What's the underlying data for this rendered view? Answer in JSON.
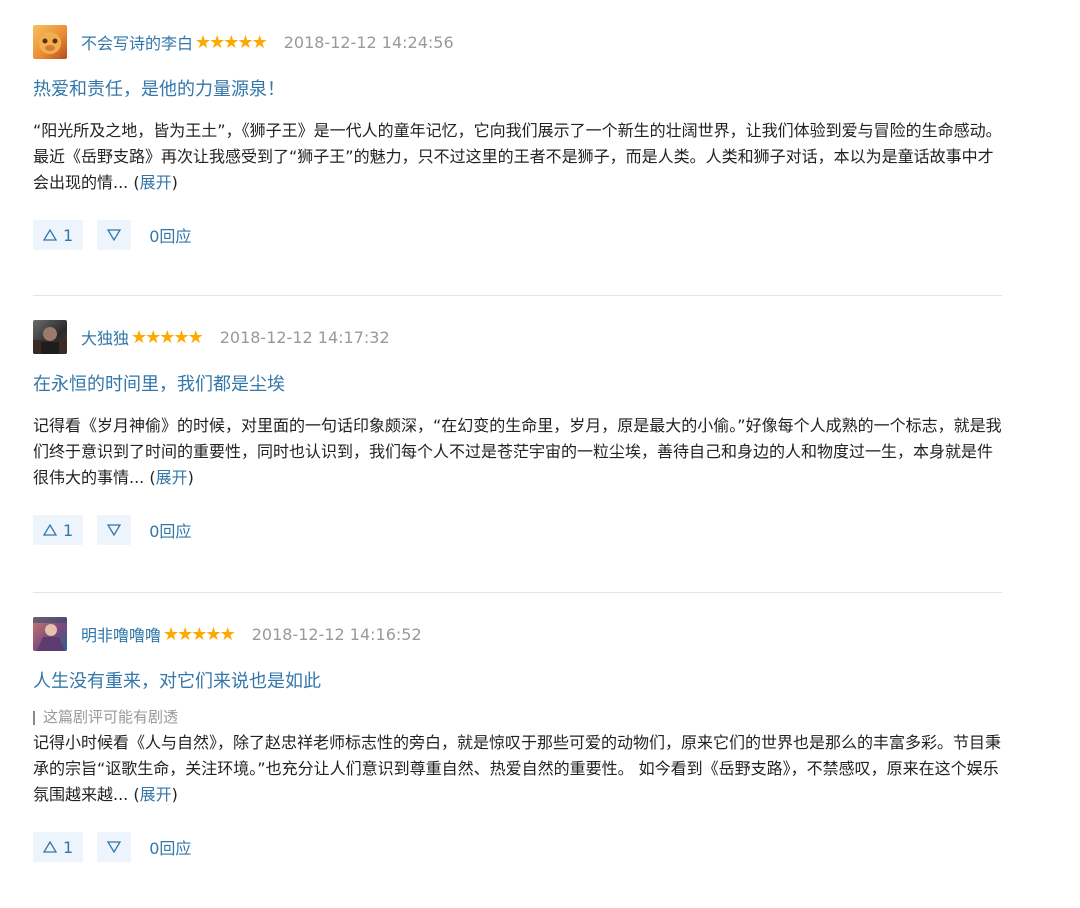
{
  "reviews": [
    {
      "username": "不会写诗的李白",
      "stars": "★★★★★",
      "time": "2018-12-12 14:24:56",
      "title": "热爱和责任，是他的力量源泉！",
      "spoiler": "",
      "text": "“阳光所及之地，皆为王土”，《狮子王》是一代人的童年记忆，它向我们展示了一个新生的壮阔世界，让我们体验到爱与冒险的生命感动。最近《岳野支路》再次让我感受到了“狮子王”的魅力，只不过这里的王者不是狮子，而是人类。人类和狮子对话，本以为是童话故事中才会出现的情... ",
      "expand": "展开",
      "up": "1",
      "reply": "0回应"
    },
    {
      "username": "大独独",
      "stars": "★★★★★",
      "time": "2018-12-12 14:17:32",
      "title": "在永恒的时间里，我们都是尘埃",
      "spoiler": "",
      "text": "记得看《岁月神偷》的时候，对里面的一句话印象颇深，“在幻变的生命里，岁月，原是最大的小偷。”好像每个人成熟的一个标志，就是我们终于意识到了时间的重要性，同时也认识到，我们每个人不过是苍茫宇宙的一粒尘埃，善待自己和身边的人和物度过一生，本身就是件很伟大的事情... ",
      "expand": "展开",
      "up": "1",
      "reply": "0回应"
    },
    {
      "username": "明非噜噜噜",
      "stars": "★★★★★",
      "time": "2018-12-12 14:16:52",
      "title": "人生没有重来，对它们来说也是如此",
      "spoiler": "这篇剧评可能有剧透",
      "text": "记得小时候看《人与自然》，除了赵忠祥老师标志性的旁白，就是惊叹于那些可爱的动物们，原来它们的世界也是那么的丰富多彩。节目秉承的宗旨“讴歌生命，关注环境。”也充分让人们意识到尊重自然、热爱自然的重要性。 如今看到《岳野支路》，不禁感叹，原来在这个娱乐氛围越来越... ",
      "expand": "展开",
      "up": "1",
      "reply": "0回应"
    }
  ],
  "colors": {
    "link": "#3377aa",
    "star": "#ffa800",
    "muted": "#999999",
    "vote_bg": "#eef4fb"
  },
  "icons": {
    "up": "triangle-up-icon",
    "down": "triangle-down-icon"
  }
}
